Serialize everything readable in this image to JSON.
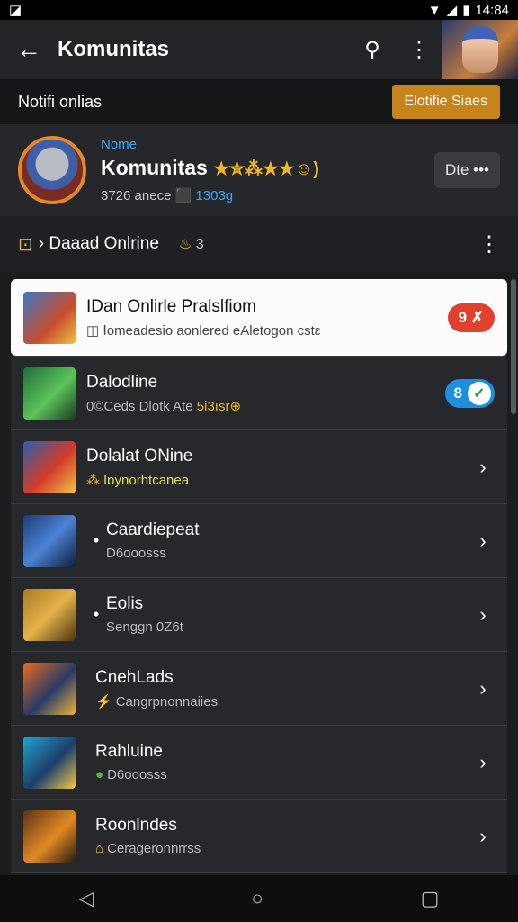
{
  "status_bar": {
    "time": "14:84"
  },
  "app_bar": {
    "title": "Komunitas"
  },
  "notification_bar": {
    "label": "Notifi onlias",
    "button_label": "Elotifie Siaes"
  },
  "profile": {
    "name_label": "Nome",
    "title": "Komunitas",
    "stars": "★✮⁂★★☺)",
    "members": "3726 anece",
    "tag": "⬛ 1303g",
    "more_button": "Dte •••"
  },
  "filter": {
    "icon": "⊡",
    "label": "› Daaad Onlrine",
    "count_icon": "♨",
    "count": "3"
  },
  "list": [
    {
      "title": "IDan Onlirle Pralslfiom",
      "subtitle": "Ⅰomeadesio aonlered eAletogon cstε",
      "sub_icon": "◫",
      "badge": "9 ✗",
      "thumb": "t1"
    },
    {
      "title": "Dalodline",
      "subtitle": "0©Ceds Dlotk Ate",
      "sub_extra": "5i3ısr⊕",
      "toggle_num": "8",
      "thumb": "t2"
    },
    {
      "title": "Dolalat ONine",
      "subtitle": "Iɒynorhtcanea",
      "sub_icon": "⁂",
      "thumb": "t3"
    },
    {
      "title": "Caardiepeat",
      "subtitle": "D6ooosss",
      "dot": "•",
      "thumb": "t4"
    },
    {
      "title": "Eolis",
      "subtitle": "Senggn 0Z6t",
      "dot": "•",
      "thumb": "t5"
    },
    {
      "title": "CnehLads",
      "subtitle": "Cangrpnonnaiies",
      "sub_icon": "⚡",
      "thumb": "t6"
    },
    {
      "title": "Rahluine",
      "subtitle": "D6ooosss",
      "sub_icon": "●",
      "thumb": "t7"
    },
    {
      "title": "Roonlndes",
      "subtitle": "Cerageronnrrss",
      "sub_icon": "⌂",
      "thumb": "t8"
    }
  ]
}
